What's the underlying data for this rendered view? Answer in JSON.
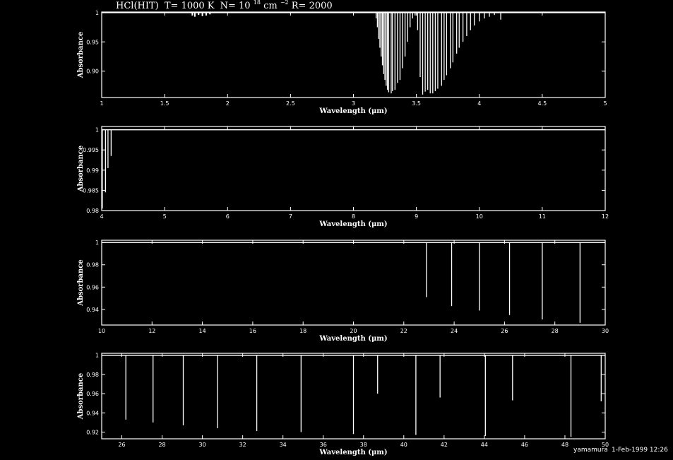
{
  "title": {
    "species": "HCl(HIT)",
    "temp_label": "T= 1000 K",
    "n_label": "N= 10",
    "n_exp": "18",
    "n_unit": " cm",
    "unit_exp": "−2",
    "r_label": " R= 2000"
  },
  "footer": {
    "author": "yamamura",
    "date": "1-Feb-1999 12:26"
  },
  "colors": {
    "background": "#000000",
    "foreground": "#ffffff"
  },
  "chart_data": [
    {
      "type": "line",
      "xlabel": "Wavelength (μm)",
      "ylabel": "Absorbance",
      "xlim": [
        1,
        5
      ],
      "ylim": [
        0.855,
        1.001
      ],
      "xticks": [
        1,
        1.5,
        2,
        2.5,
        3,
        3.5,
        4,
        4.5,
        5
      ],
      "xticklabels": [
        "1",
        "1.5",
        "2",
        "2.5",
        "3",
        "3.5",
        "4",
        "4.5",
        "5"
      ],
      "yticks": [
        0.9,
        0.95,
        1
      ],
      "yticklabels": [
        "0.90",
        "0.95",
        "1"
      ],
      "lines": [
        {
          "x": 3.18,
          "y": 0.99
        },
        {
          "x": 3.19,
          "y": 0.975
        },
        {
          "x": 3.2,
          "y": 0.955
        },
        {
          "x": 3.21,
          "y": 0.94
        },
        {
          "x": 3.22,
          "y": 0.925
        },
        {
          "x": 3.23,
          "y": 0.91
        },
        {
          "x": 3.24,
          "y": 0.895
        },
        {
          "x": 3.25,
          "y": 0.885
        },
        {
          "x": 3.26,
          "y": 0.875
        },
        {
          "x": 3.27,
          "y": 0.868
        },
        {
          "x": 3.28,
          "y": 0.864
        },
        {
          "x": 3.3,
          "y": 0.862
        },
        {
          "x": 3.31,
          "y": 0.866
        },
        {
          "x": 3.33,
          "y": 0.868
        },
        {
          "x": 3.35,
          "y": 0.88
        },
        {
          "x": 3.37,
          "y": 0.885
        },
        {
          "x": 3.39,
          "y": 0.905
        },
        {
          "x": 3.41,
          "y": 0.925
        },
        {
          "x": 3.43,
          "y": 0.95
        },
        {
          "x": 3.45,
          "y": 0.975
        },
        {
          "x": 3.47,
          "y": 0.99
        },
        {
          "x": 3.49,
          "y": 0.995
        },
        {
          "x": 3.51,
          "y": 0.97
        },
        {
          "x": 3.53,
          "y": 0.89
        },
        {
          "x": 3.55,
          "y": 0.86
        },
        {
          "x": 3.57,
          "y": 0.865
        },
        {
          "x": 3.59,
          "y": 0.868
        },
        {
          "x": 3.61,
          "y": 0.862
        },
        {
          "x": 3.63,
          "y": 0.862
        },
        {
          "x": 3.65,
          "y": 0.866
        },
        {
          "x": 3.67,
          "y": 0.87
        },
        {
          "x": 3.7,
          "y": 0.875
        },
        {
          "x": 3.72,
          "y": 0.885
        },
        {
          "x": 3.74,
          "y": 0.893
        },
        {
          "x": 3.77,
          "y": 0.905
        },
        {
          "x": 3.79,
          "y": 0.915
        },
        {
          "x": 3.82,
          "y": 0.93
        },
        {
          "x": 3.84,
          "y": 0.94
        },
        {
          "x": 3.87,
          "y": 0.95
        },
        {
          "x": 3.9,
          "y": 0.96
        },
        {
          "x": 3.93,
          "y": 0.97
        },
        {
          "x": 3.96,
          "y": 0.978
        },
        {
          "x": 4.0,
          "y": 0.985
        },
        {
          "x": 4.04,
          "y": 0.99
        },
        {
          "x": 4.08,
          "y": 0.993
        },
        {
          "x": 4.12,
          "y": 0.996
        },
        {
          "x": 4.17,
          "y": 0.988
        }
      ],
      "bumps": [
        {
          "x": 1.72,
          "y": 0.995
        },
        {
          "x": 1.74,
          "y": 0.993
        },
        {
          "x": 1.77,
          "y": 0.996
        },
        {
          "x": 1.8,
          "y": 0.994
        },
        {
          "x": 1.83,
          "y": 0.995
        },
        {
          "x": 1.86,
          "y": 0.997
        }
      ]
    },
    {
      "type": "line",
      "xlabel": "Wavelength (μm)",
      "ylabel": "Absorbance",
      "xlim": [
        4,
        12
      ],
      "ylim": [
        0.98,
        1.0008
      ],
      "xticks": [
        4,
        5,
        6,
        7,
        8,
        9,
        10,
        11,
        12
      ],
      "xticklabels": [
        "4",
        "5",
        "6",
        "7",
        "8",
        "9",
        "10",
        "11",
        "12"
      ],
      "yticks": [
        0.98,
        0.985,
        0.99,
        0.995,
        1
      ],
      "yticklabels": [
        "0.98",
        "0.985",
        "0.99",
        "0.995",
        "1"
      ],
      "lines": [
        {
          "x": 4.01,
          "y": 0.9805
        },
        {
          "x": 4.06,
          "y": 0.9845
        },
        {
          "x": 4.1,
          "y": 0.9905
        },
        {
          "x": 4.15,
          "y": 0.9935
        }
      ]
    },
    {
      "type": "line",
      "xlabel": "Wavelength (μm)",
      "ylabel": "Absorbance",
      "xlim": [
        10,
        30
      ],
      "ylim": [
        0.926,
        1.002
      ],
      "xticks": [
        10,
        12,
        14,
        16,
        18,
        20,
        22,
        24,
        26,
        28,
        30
      ],
      "xticklabels": [
        "10",
        "12",
        "14",
        "16",
        "18",
        "20",
        "22",
        "24",
        "26",
        "28",
        "30"
      ],
      "yticks": [
        0.94,
        0.96,
        0.98,
        1
      ],
      "yticklabels": [
        "0.94",
        "0.96",
        "0.98",
        "1"
      ],
      "lines": [
        {
          "x": 22.9,
          "y": 0.951
        },
        {
          "x": 23.9,
          "y": 0.943
        },
        {
          "x": 25.0,
          "y": 0.939
        },
        {
          "x": 26.2,
          "y": 0.935
        },
        {
          "x": 27.5,
          "y": 0.931
        },
        {
          "x": 29.0,
          "y": 0.928
        }
      ]
    },
    {
      "type": "line",
      "xlabel": "Wavelength (μm)",
      "ylabel": "Absorbance",
      "xlim": [
        25,
        50
      ],
      "ylim": [
        0.913,
        1.002
      ],
      "xticks": [
        26,
        28,
        30,
        32,
        34,
        36,
        38,
        40,
        42,
        44,
        46,
        48,
        50
      ],
      "xticklabels": [
        "26",
        "28",
        "30",
        "32",
        "34",
        "36",
        "38",
        "40",
        "42",
        "44",
        "46",
        "48",
        "50"
      ],
      "yticks": [
        0.92,
        0.94,
        0.96,
        0.98,
        1
      ],
      "yticklabels": [
        "0.92",
        "0.94",
        "0.96",
        "0.98",
        "1"
      ],
      "lines": [
        {
          "x": 26.2,
          "y": 0.933
        },
        {
          "x": 27.55,
          "y": 0.93
        },
        {
          "x": 29.05,
          "y": 0.927
        },
        {
          "x": 30.75,
          "y": 0.924
        },
        {
          "x": 32.7,
          "y": 0.921
        },
        {
          "x": 34.9,
          "y": 0.92
        },
        {
          "x": 37.5,
          "y": 0.918
        },
        {
          "x": 38.7,
          "y": 0.96
        },
        {
          "x": 40.6,
          "y": 0.917
        },
        {
          "x": 41.8,
          "y": 0.956
        },
        {
          "x": 44.05,
          "y": 0.916
        },
        {
          "x": 45.4,
          "y": 0.953
        },
        {
          "x": 48.3,
          "y": 0.915
        },
        {
          "x": 49.8,
          "y": 0.952
        }
      ]
    }
  ]
}
